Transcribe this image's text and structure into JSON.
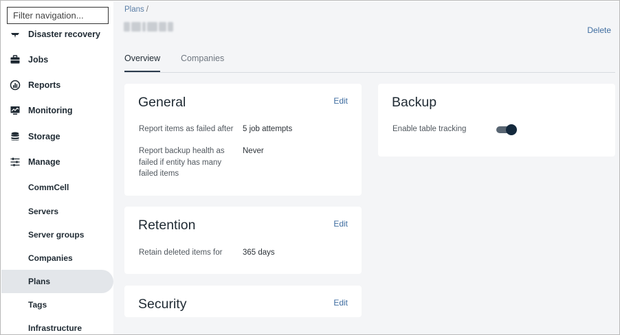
{
  "sidebar": {
    "filter_placeholder": "Filter navigation...",
    "items": [
      {
        "label": "Disaster recovery",
        "icon": "disaster-recovery-icon"
      },
      {
        "label": "Jobs",
        "icon": "briefcase-icon"
      },
      {
        "label": "Reports",
        "icon": "reports-chart-icon"
      },
      {
        "label": "Monitoring",
        "icon": "monitor-icon"
      },
      {
        "label": "Storage",
        "icon": "database-icon"
      },
      {
        "label": "Manage",
        "icon": "sliders-icon"
      }
    ],
    "sub_items": [
      {
        "label": "CommCell",
        "active": false
      },
      {
        "label": "Servers",
        "active": false
      },
      {
        "label": "Server groups",
        "active": false
      },
      {
        "label": "Companies",
        "active": false
      },
      {
        "label": "Plans",
        "active": true
      },
      {
        "label": "Tags",
        "active": false
      },
      {
        "label": "Infrastructure",
        "active": false
      }
    ]
  },
  "header": {
    "breadcrumb": "Plans",
    "breadcrumb_separator": "/",
    "delete_label": "Delete"
  },
  "tabs": [
    {
      "label": "Overview",
      "active": true
    },
    {
      "label": "Companies",
      "active": false
    }
  ],
  "general": {
    "title": "General",
    "edit_label": "Edit",
    "rows": [
      {
        "label": "Report items as failed after",
        "value": "5 job attempts"
      },
      {
        "label": "Report backup health as failed if entity has many failed items",
        "value": "Never"
      }
    ]
  },
  "retention": {
    "title": "Retention",
    "edit_label": "Edit",
    "rows": [
      {
        "label": "Retain deleted items for",
        "value": "365 days"
      }
    ]
  },
  "security": {
    "title": "Security",
    "edit_label": "Edit"
  },
  "backup": {
    "title": "Backup",
    "table_tracking_label": "Enable table tracking",
    "table_tracking_enabled": true
  },
  "colors": {
    "accent": "#3f6da0",
    "sidebar_active": "#e3e6ea",
    "toggle_on": "#14293d",
    "main_bg": "#f4f5f7"
  }
}
